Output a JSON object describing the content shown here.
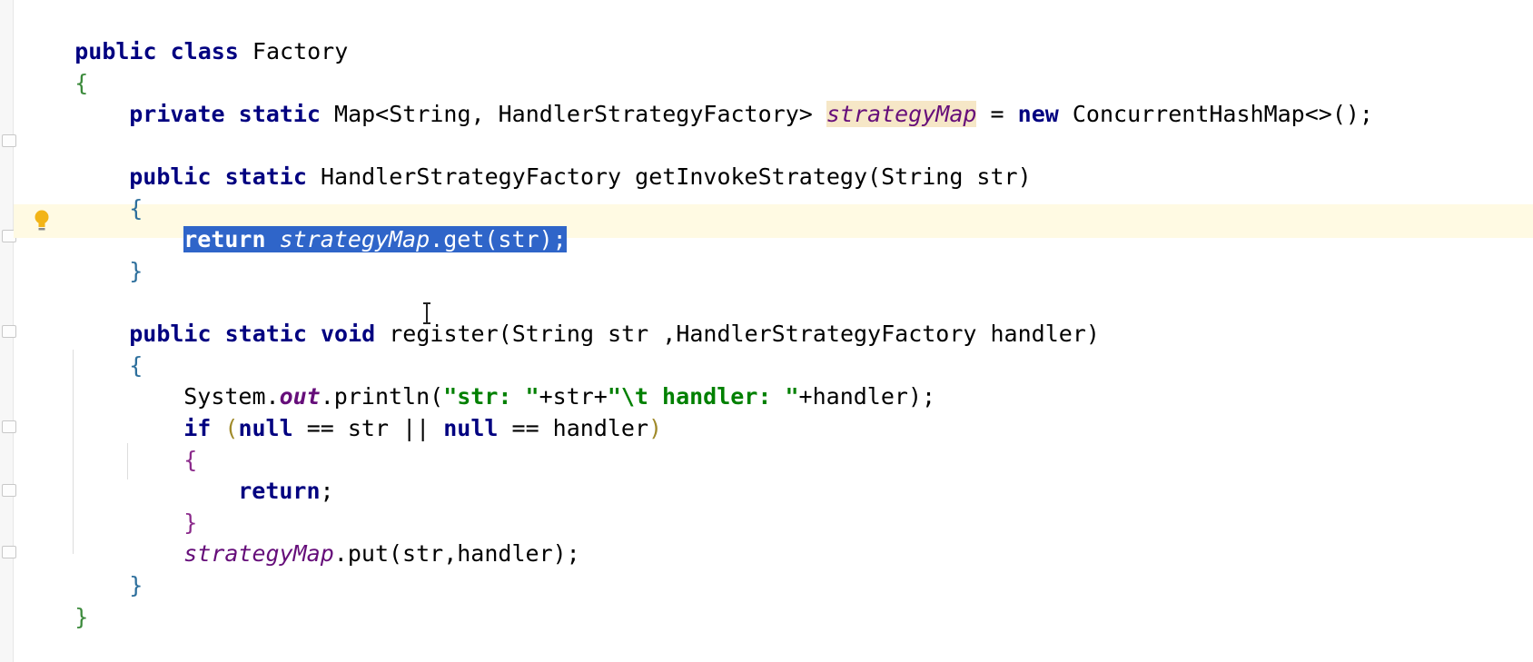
{
  "editor": {
    "language": "Java",
    "class_header": {
      "public": "public",
      "class": "class",
      "name": "Factory"
    },
    "open_brace": "{",
    "close_brace": "}",
    "field_line": {
      "private": "private",
      "static": "static",
      "type": "Map<String, HandlerStrategyFactory>",
      "name": "strategyMap",
      "assign": "=",
      "new": "new",
      "init": "ConcurrentHashMap<>();"
    },
    "method1": {
      "public": "public",
      "static": "static",
      "signature": "HandlerStrategyFactory getInvokeStrategy(String str)",
      "open": "{",
      "return_kw": "return",
      "return_field": "strategyMap",
      "return_rest": ".get(str);",
      "close": "}"
    },
    "method2": {
      "public": "public",
      "static": "static",
      "void": "void",
      "signature": "register(String str ,HandlerStrategyFactory handler)",
      "open": "{",
      "print_prefix": "System.",
      "print_out": "out",
      "print_call": ".println(",
      "print_str1": "\"str: \"",
      "print_plus1": "+str+",
      "print_str2": "\"\\t handler: \"",
      "print_end": "+handler);",
      "if_kw": "if",
      "if_cond_a": "(",
      "null1": "null",
      "if_cond_b": " == str || ",
      "null2": "null",
      "if_cond_c": " == handler",
      "if_close": ")",
      "if_open_brace": "{",
      "return_stmt": "return",
      "return_semicolon": ";",
      "if_close_brace": "}",
      "put_field": "strategyMap",
      "put_rest": ".put(str,handler);",
      "close": "}"
    }
  },
  "colors": {
    "keyword": "#000080",
    "string": "#008000",
    "field": "#660e7a",
    "selection": "#2f65c9",
    "caret_row": "#fffae3"
  },
  "icons": {
    "intention": "lightbulb-icon",
    "cursor": "text-cursor-icon"
  }
}
